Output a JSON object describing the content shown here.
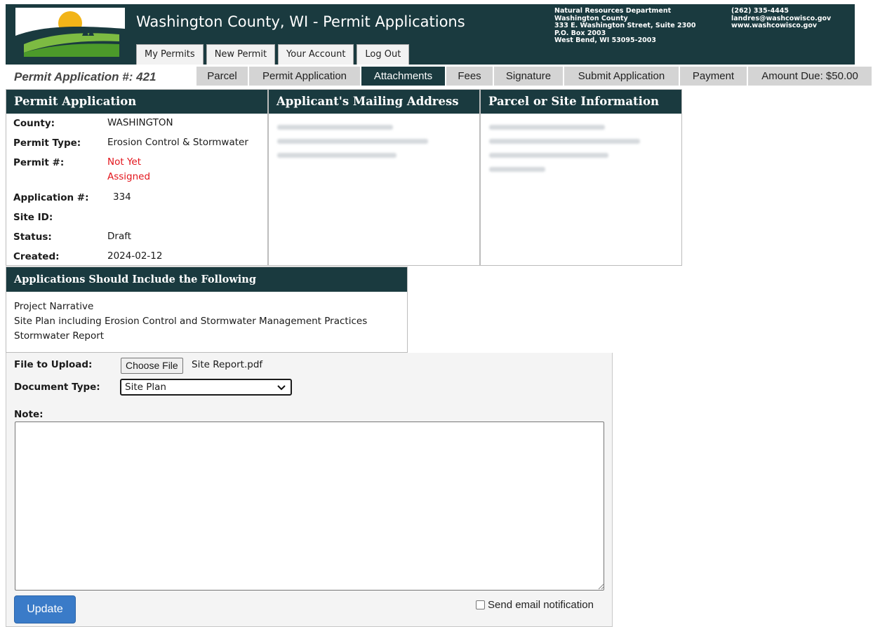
{
  "header": {
    "title": "Washington County, WI - Permit Applications",
    "address_lines": [
      "Natural Resources Department",
      "Washington County",
      "333 E. Washington Street, Suite 2300",
      "P.O. Box 2003",
      "West Bend, WI 53095-2003"
    ],
    "contact_lines": [
      "(262) 335-4445",
      "landres@washcowisco.gov",
      "www.washcowisco.gov"
    ],
    "nav": [
      {
        "label": "My Permits"
      },
      {
        "label": "New Permit"
      },
      {
        "label": "Your Account"
      },
      {
        "label": "Log Out"
      }
    ]
  },
  "subnav": {
    "app_number": "Permit Application #: 421",
    "tabs": [
      {
        "label": "Parcel",
        "active": false
      },
      {
        "label": "Permit Application",
        "active": false
      },
      {
        "label": "Attachments",
        "active": true
      },
      {
        "label": "Fees",
        "active": false
      },
      {
        "label": "Signature",
        "active": false
      },
      {
        "label": "Submit Application",
        "active": false
      },
      {
        "label": "Payment",
        "active": false
      },
      {
        "label": "Amount Due: $50.00",
        "active": false
      }
    ]
  },
  "permit_panel": {
    "heading": "Permit Application",
    "rows": [
      {
        "label": "County:",
        "value": "WASHINGTON"
      },
      {
        "label": "Permit Type:",
        "value": "Erosion Control & Stormwater"
      },
      {
        "label": "Permit #:",
        "value": "Not Yet",
        "value2": "Assigned"
      },
      {
        "label": "Application #:",
        "value": "334"
      },
      {
        "label": "Site ID:",
        "value": ""
      },
      {
        "label": "Status:",
        "value": "Draft"
      },
      {
        "label": "Created:",
        "value": "2024-02-12"
      }
    ]
  },
  "mailing_panel": {
    "heading": "Applicant's Mailing Address"
  },
  "site_panel": {
    "heading": "Parcel or Site Information"
  },
  "include_panel": {
    "heading": "Applications Should Include the Following",
    "items": [
      "Project Narrative",
      "Site Plan including Erosion Control and Stormwater Management Practices",
      "Stormwater Report"
    ]
  },
  "upload": {
    "file_label": "File to Upload:",
    "choose_button": "Choose File",
    "file_name": "Site Report.pdf",
    "doc_type_label": "Document Type:",
    "doc_type_value": "Site Plan",
    "note_label": "Note:",
    "note_value": "",
    "update_button": "Update",
    "email_notification_label": "Send email notification",
    "email_notification_checked": false
  },
  "colors": {
    "header_bg": "#1a3a3f",
    "active_tab_bg": "#1a3a3f",
    "inactive_tab_bg": "#d4d4d4",
    "alert_red": "#e3141b",
    "button_blue": "#3a7bc8"
  },
  "icons": {
    "logo": "county-logo-sun-hills-icon",
    "select_arrow": "chevron-down-icon"
  }
}
